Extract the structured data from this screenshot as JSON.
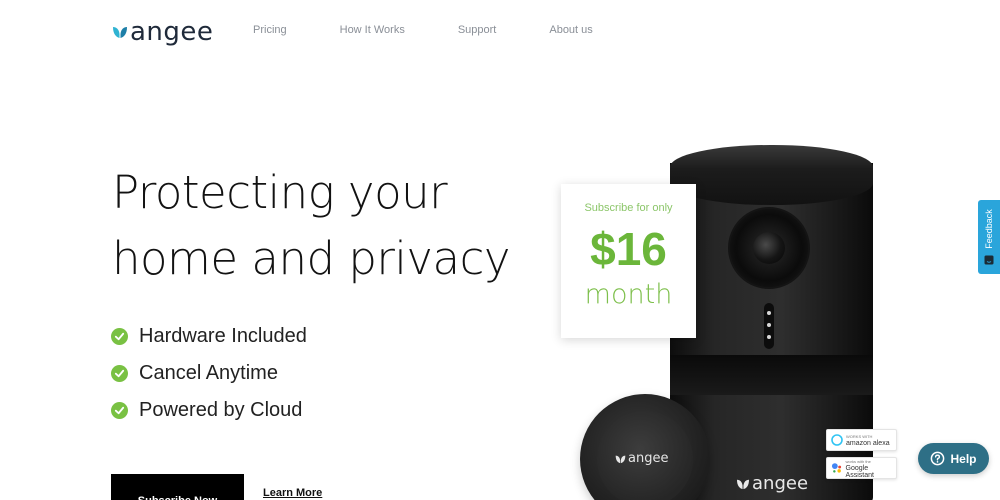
{
  "brand": {
    "name": "angee",
    "logo_icon": "leaf-heart-logo-icon",
    "accent": "#3ab0d0"
  },
  "nav": {
    "items": [
      "Pricing",
      "How It Works",
      "Support",
      "About us"
    ]
  },
  "hero": {
    "title_lines": [
      "Protecting your",
      "home and privacy"
    ],
    "features": [
      "Hardware Included",
      "Cancel Anytime",
      "Powered by Cloud"
    ],
    "feature_icon": "check-circle-icon",
    "check_color": "#79c143",
    "cta_label": "Subscribe Now",
    "secondary_label": "Learn More"
  },
  "pricing": {
    "subtitle": "Subscribe for only",
    "amount": "$16",
    "period": "month",
    "price_color": "#6bb63a"
  },
  "product": {
    "device_brand": "angee",
    "puck_brand": "angee"
  },
  "badges": [
    {
      "small": "WORKS WITH",
      "large": "amazon alexa",
      "icon": "alexa-ring-icon"
    },
    {
      "small": "works with the",
      "large": "Google Assistant",
      "icon": "google-assistant-icon"
    }
  ],
  "feedback": {
    "label": "Feedback",
    "color": "#2aa5db"
  },
  "help": {
    "label": "Help",
    "icon": "question-circle-icon",
    "color": "#2e6f86"
  }
}
